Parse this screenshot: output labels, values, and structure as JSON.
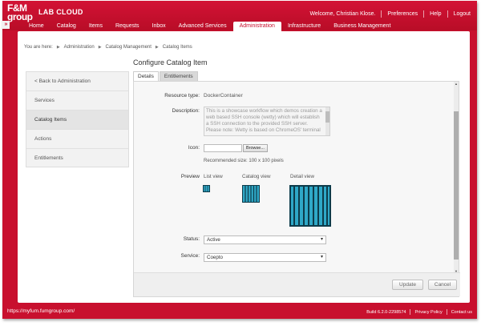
{
  "header": {
    "logo_top": "F&M",
    "logo_bottom": "group",
    "app_title": "LAB CLOUD",
    "expand_glyph": "»",
    "welcome": "Welcome, Christian Klose.",
    "links": [
      "Preferences",
      "Help",
      "Logout"
    ]
  },
  "nav": {
    "items": [
      "Home",
      "Catalog",
      "Items",
      "Requests",
      "Inbox",
      "Advanced Services",
      "Administration",
      "Infrastructure",
      "Business Management"
    ],
    "active": "Administration"
  },
  "breadcrumb": {
    "prefix": "You are here:",
    "items": [
      "Administration",
      "Catalog Management",
      "Catalog Items"
    ]
  },
  "page_title": "Configure Catalog Item",
  "sidebar": {
    "items": [
      "< Back to Administration",
      "Services",
      "Catalog Items",
      "Actions",
      "Entitlements"
    ],
    "active": "Catalog Items"
  },
  "tabs": {
    "items": [
      "Details",
      "Entitlements"
    ],
    "active": "Details"
  },
  "form": {
    "resource_type_label": "Resource type:",
    "resource_type_value": "DockerContainer",
    "description_label": "Description:",
    "description_lines": [
      "This is a showcase workflow which demos creation a",
      "web based SSH console (wetty) which will establish",
      "a SSH connection to the provided SSH server.",
      "Please note: Wetty is based on ChromeOS' terminal"
    ],
    "icon_label": "Icon:",
    "icon_value": "",
    "browse_label": "Browse...",
    "icon_hint": "Recommended size: 100 x 100 pixels",
    "preview_label": "Preview",
    "preview_list_view": "List view",
    "preview_catalog_view": "Catalog view",
    "preview_detail_view": "Detail view",
    "status_label": "Status:",
    "status_value": "Active",
    "service_label": "Service:",
    "service_value": "Coepto"
  },
  "buttons": {
    "update": "Update",
    "cancel": "Cancel"
  },
  "footer": {
    "url": "https://myfum.fumgroup.com/",
    "build": "Build 6.2.0-2298574",
    "privacy": "Privacy Policy",
    "contact": "Contact us"
  },
  "colors": {
    "brand_red": "#c8102e",
    "preview_teal": "#2fa8c7"
  }
}
